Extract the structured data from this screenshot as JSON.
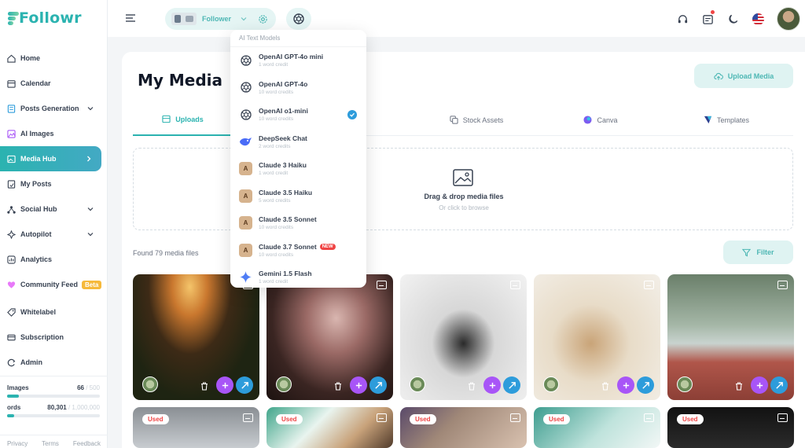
{
  "brand": {
    "name": "Followr",
    "accent": "#2bb3b0"
  },
  "sidebar": {
    "items": [
      {
        "label": "Home",
        "icon": "home-icon"
      },
      {
        "label": "Calendar",
        "icon": "calendar-icon"
      },
      {
        "label": "Posts Generation",
        "icon": "posts-generation-icon",
        "expandable": true
      },
      {
        "label": "AI Images",
        "icon": "ai-images-icon"
      },
      {
        "label": "Media Hub",
        "icon": "media-hub-icon",
        "active": true
      },
      {
        "label": "My Posts",
        "icon": "my-posts-icon"
      },
      {
        "label": "Social Hub",
        "icon": "social-hub-icon",
        "expandable": true
      },
      {
        "label": "Autopilot",
        "icon": "autopilot-icon",
        "expandable": true
      },
      {
        "label": "Analytics",
        "icon": "analytics-icon"
      },
      {
        "label": "Community Feed",
        "icon": "community-feed-icon",
        "badge": "Beta"
      },
      {
        "label": "Whitelabel",
        "icon": "whitelabel-icon"
      },
      {
        "label": "Subscription",
        "icon": "subscription-icon"
      },
      {
        "label": "Admin",
        "icon": "admin-icon"
      }
    ],
    "usage": [
      {
        "label": "Images",
        "value": "66",
        "limit": "/ 500",
        "fraction": 0.13
      },
      {
        "label": "ords",
        "value": "80,301",
        "limit": "/ 1,000,000",
        "fraction": 0.08
      }
    ],
    "footer": [
      "Privacy",
      "Terms",
      "Feedback"
    ]
  },
  "topbar": {
    "brand_select": "Follower",
    "icons": [
      "headset-icon",
      "notification-icon",
      "moon-icon",
      "us-flag-icon",
      "user-avatar"
    ]
  },
  "model_dropdown": {
    "header": "AI Text Models",
    "models": [
      {
        "name": "OpenAI GPT-4o mini",
        "credits": "1 word credit",
        "icon": "openai-icon"
      },
      {
        "name": "OpenAI GPT-4o",
        "credits": "10 word credits",
        "icon": "openai-icon"
      },
      {
        "name": "OpenAI o1-mini",
        "credits": "10 word credits",
        "icon": "openai-icon",
        "selected": true
      },
      {
        "name": "DeepSeek Chat",
        "credits": "2 word credits",
        "icon": "deepseek-icon"
      },
      {
        "name": "Claude 3 Haiku",
        "credits": "1 word credit",
        "icon": "claude-icon"
      },
      {
        "name": "Claude 3.5 Haiku",
        "credits": "5 word credits",
        "icon": "claude-icon"
      },
      {
        "name": "Claude 3.5 Sonnet",
        "credits": "10 word credits",
        "icon": "claude-icon"
      },
      {
        "name": "Claude 3.7 Sonnet",
        "credits": "10 word credits",
        "icon": "claude-icon",
        "tag": "NEW"
      },
      {
        "name": "Gemini 1.5 Flash",
        "credits": "1 word credit",
        "icon": "gemini-icon"
      }
    ]
  },
  "main": {
    "title": "My Media",
    "upload_button": "Upload Media",
    "tabs": [
      {
        "label": "Uploads",
        "active": true
      },
      {
        "label": "Stock Assets"
      },
      {
        "label": "Canva"
      },
      {
        "label": "Templates"
      }
    ],
    "dropzone": {
      "title": "Drag & drop media files",
      "subtitle": "Or click to browse"
    },
    "found_text": "Found 79 media files",
    "filter_button": "Filter",
    "media": [
      {
        "description": "sunset-flower-field",
        "used": false
      },
      {
        "description": "two-singers-on-stage",
        "used": false
      },
      {
        "description": "man-sitting-studio",
        "used": false
      },
      {
        "description": "two-women-embracing",
        "used": false
      },
      {
        "description": "runner-on-track",
        "used": false
      },
      {
        "description": "media-6",
        "used": true
      },
      {
        "description": "media-7",
        "used": true
      },
      {
        "description": "media-8",
        "used": true
      },
      {
        "description": "media-9",
        "used": true
      },
      {
        "description": "chalkboard-note",
        "used": true
      }
    ],
    "used_label": "Used"
  }
}
